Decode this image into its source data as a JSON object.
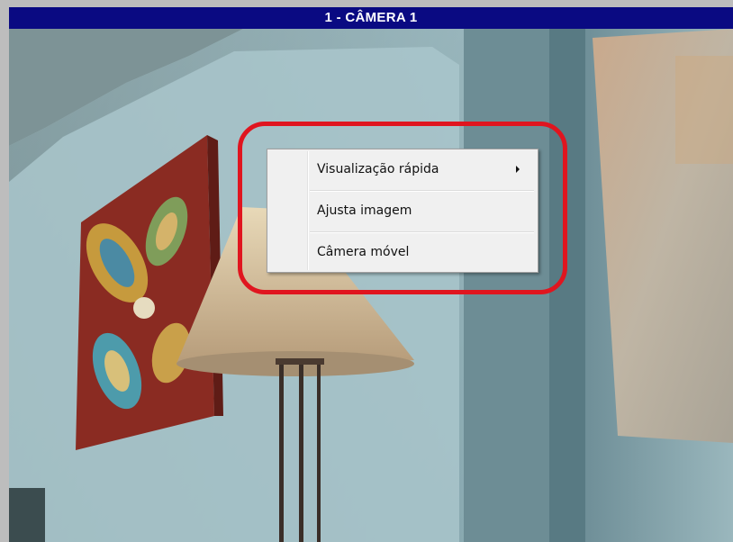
{
  "window": {
    "title": "1 - CÂMERA 1"
  },
  "context_menu": {
    "items": [
      {
        "label": "Visualização rápida",
        "icon": "submenu-arrow-icon"
      },
      {
        "label": "Ajusta imagem"
      },
      {
        "label": "Câmera móvel"
      }
    ]
  },
  "colors": {
    "titlebar": "#0a0a82",
    "titlebar_text": "#ffffff",
    "highlight_ring": "#e0151f",
    "menu_bg": "#f0f0f0"
  }
}
